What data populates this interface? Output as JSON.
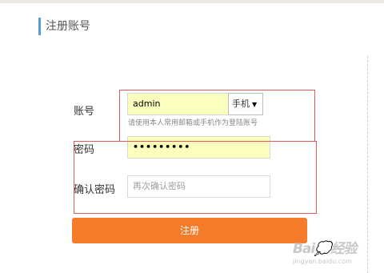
{
  "header": {
    "title": "注册账号"
  },
  "form": {
    "account": {
      "label": "账号",
      "value": "admin",
      "type_select": "手机",
      "caret": "▼",
      "hint": "请使用本人常用邮箱或手机作为登陆账号"
    },
    "password": {
      "label": "密码",
      "value": "•••••••••"
    },
    "confirm": {
      "label": "确认密码",
      "placeholder": "再次确认密码"
    },
    "submit_label": "注册"
  },
  "watermark": {
    "logo": "Bai💭经验",
    "url": "jingyan.baidu.com"
  },
  "colors": {
    "accent_bar": "#5b9bd5",
    "autofill_bg": "#faffbd",
    "button": "#f47b2a",
    "annotation": "#e05a5a"
  }
}
